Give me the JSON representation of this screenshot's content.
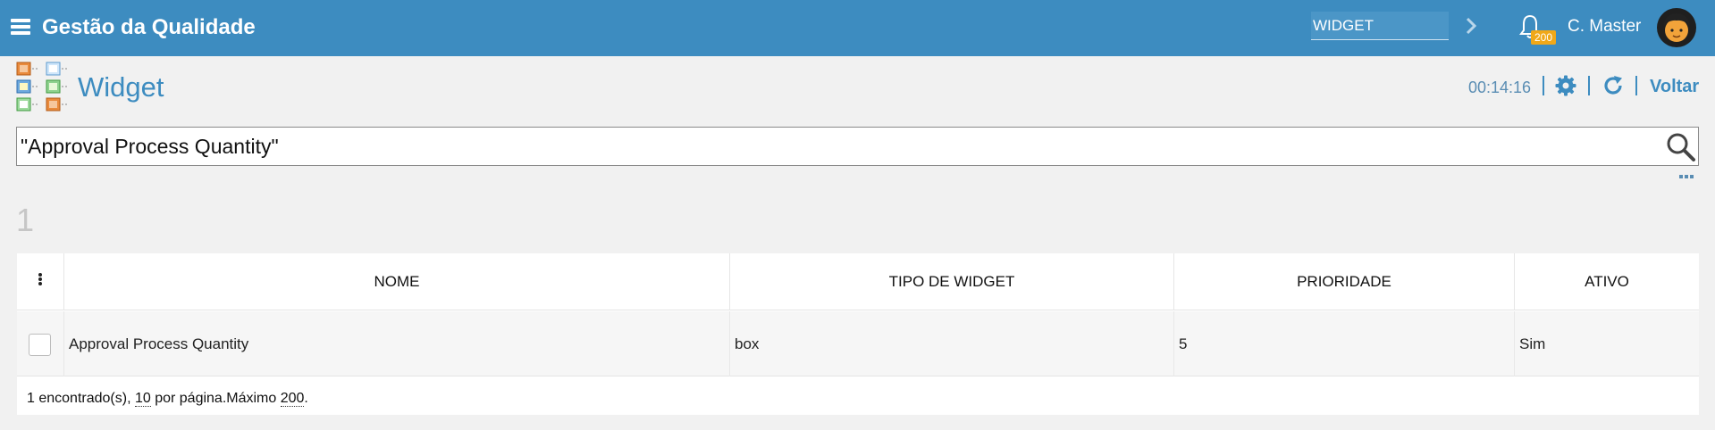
{
  "topbar": {
    "app_title": "Gestão da Qualidade",
    "nav_search_value": "WIDGET",
    "notification_count": "200",
    "user_name": "C. Master",
    "background_color": "#3d8cc0",
    "badge_color": "#f0a818"
  },
  "page": {
    "title": "Widget",
    "timer": "00:14:16",
    "back_label": "Voltar"
  },
  "search": {
    "value": "\"Approval Process Quantity\""
  },
  "results": {
    "count": "1"
  },
  "table": {
    "columns": [
      "NOME",
      "TIPO DE WIDGET",
      "PRIORIDADE",
      "ATIVO"
    ],
    "rows": [
      [
        "Approval Process Quantity",
        "box",
        "5",
        "Sim"
      ]
    ]
  },
  "footer": {
    "found": "1 encontrado(s), ",
    "per_page_value": "10",
    "per_page_text": " por página.",
    "max_label": "Máximo ",
    "max_value": "200",
    "end": "."
  },
  "icons": {
    "menu": "hamburger-icon",
    "nav": "chevron-right-icon",
    "notifications": "bell-icon",
    "settings": "gear-icon",
    "refresh": "refresh-icon",
    "search": "search-icon",
    "more": "more-icon",
    "column_menu": "kebab-icon"
  }
}
